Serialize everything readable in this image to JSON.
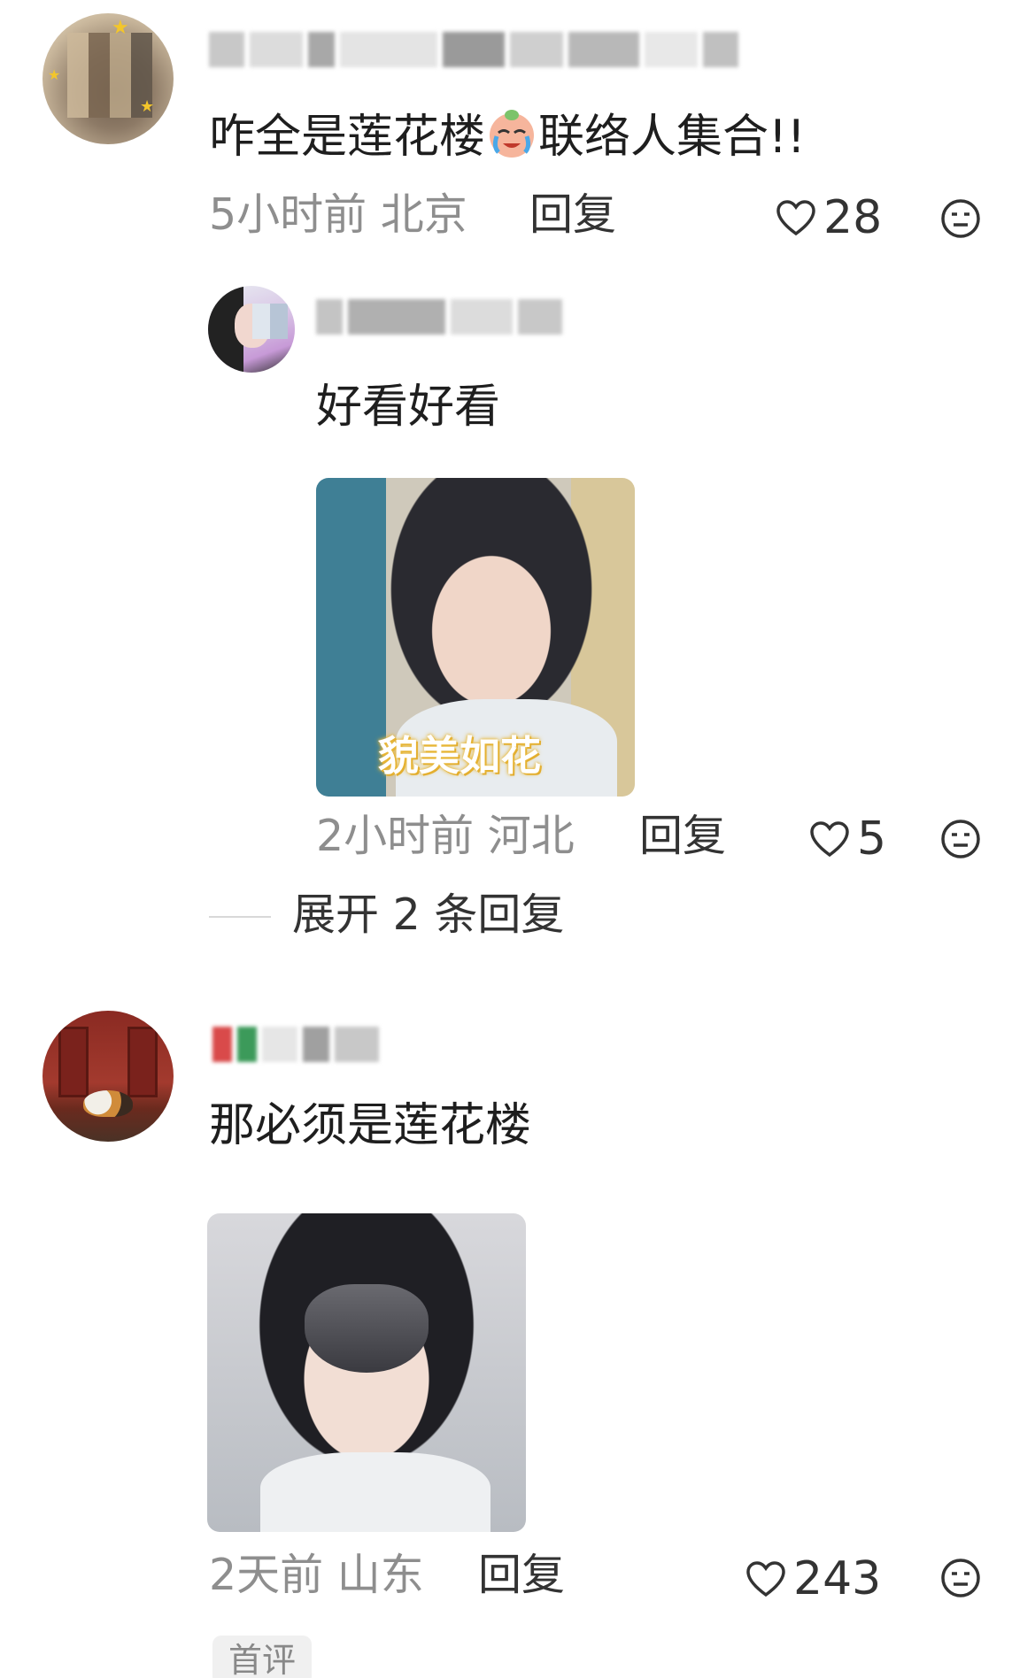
{
  "comments": [
    {
      "text_before": "咋全是莲花楼",
      "emoji": "crying-face-emoji",
      "text_after": "联络人集合!!",
      "time": "5小时前",
      "location": "北京",
      "reply_label": "回复",
      "likes": "28"
    },
    {
      "text": "好看好看",
      "image_caption": "貌美如花",
      "time": "2小时前",
      "location": "河北",
      "reply_label": "回复",
      "likes": "5",
      "expand_label": "展开 2 条回复"
    },
    {
      "text": "那必须是莲花楼",
      "time": "2天前",
      "location": "山东",
      "reply_label": "回复",
      "likes": "243",
      "badge": "首评"
    }
  ],
  "icons": {
    "like": "heart-outline-icon",
    "react": "neutral-face-icon"
  },
  "colors": {
    "meta": "#8e8e8e",
    "text": "#1e1e1e"
  }
}
